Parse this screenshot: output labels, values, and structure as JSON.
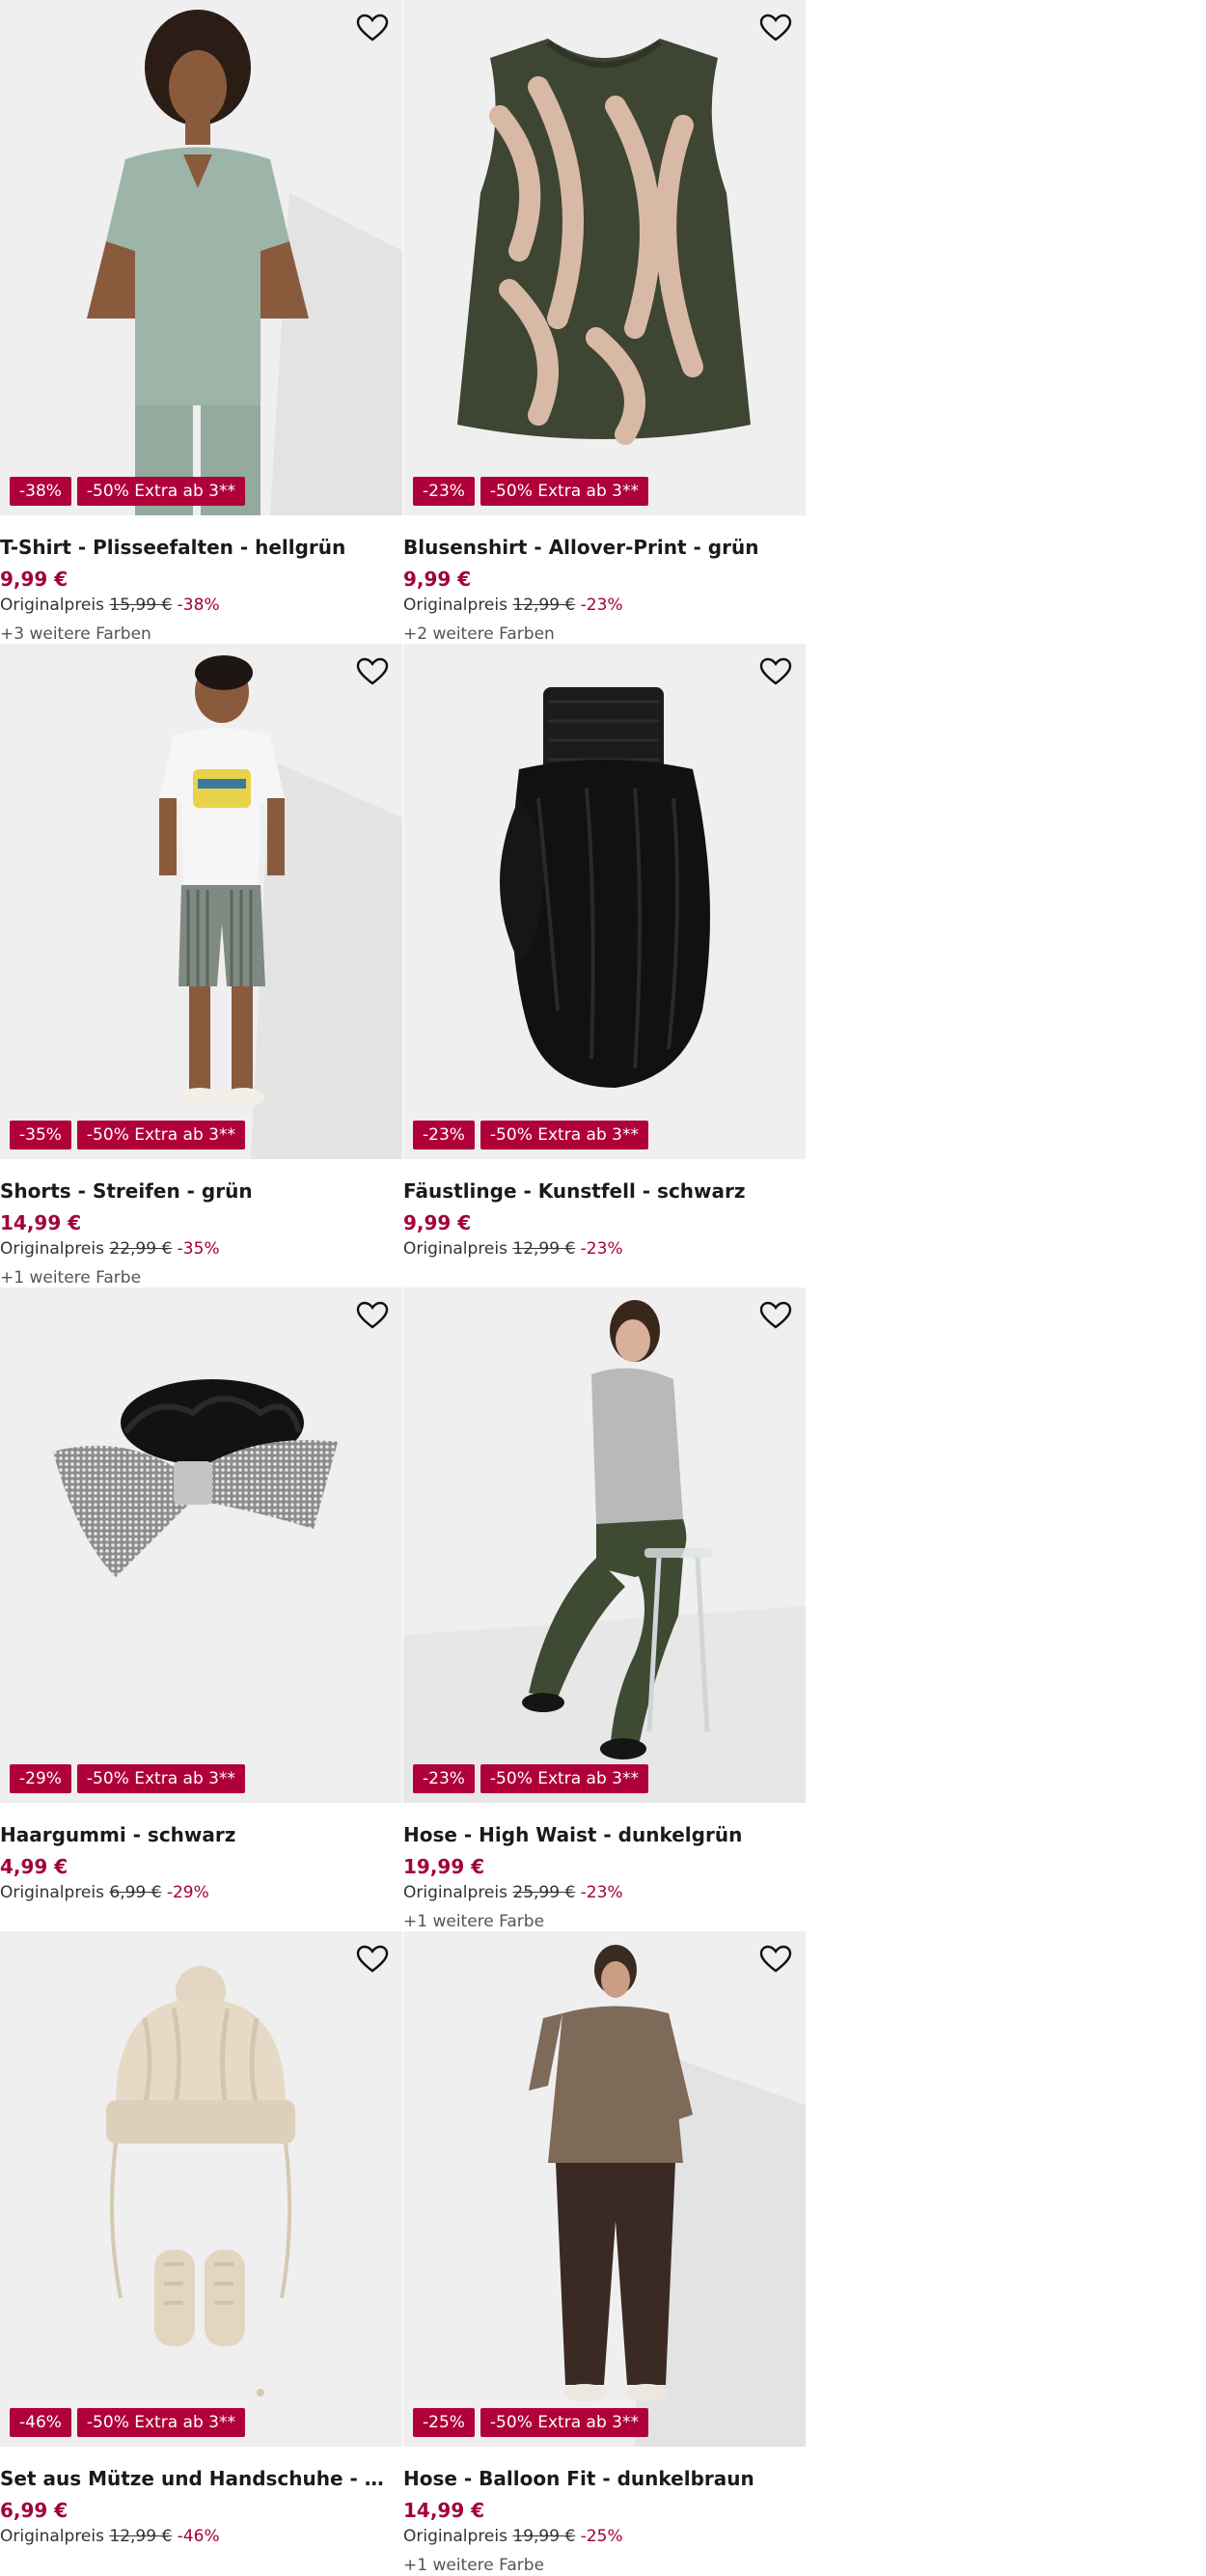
{
  "labels": {
    "original_prefix": "Originalpreis",
    "extra_badge": "-50% Extra ab 3**"
  },
  "colors": {
    "badge": "#b0003a",
    "price": "#a3003a",
    "image_bg": "#efefef"
  },
  "products": [
    {
      "title": "T-Shirt - Plisseefalten - hellgrün",
      "price": "9,99 €",
      "original_price": "15,99 €",
      "discount": "-38%",
      "more_colors": "+3 weitere Farben",
      "image": "woman-in-sage-green-pleated-tshirt"
    },
    {
      "title": "Blusenshirt - Allover-Print - grün",
      "price": "9,99 €",
      "original_price": "12,99 €",
      "discount": "-23%",
      "more_colors": "+2 weitere Farben",
      "image": "green-sleeveless-blouse-with-leaf-print"
    },
    {
      "title": "Shorts - Streifen - grün",
      "price": "14,99 €",
      "original_price": "22,99 €",
      "discount": "-35%",
      "more_colors": "+1 weitere Farbe",
      "image": "man-in-striped-shorts-and-print-tshirt"
    },
    {
      "title": "Fäustlinge - Kunstfell - schwarz",
      "price": "9,99 €",
      "original_price": "12,99 €",
      "discount": "-23%",
      "more_colors": "",
      "image": "black-faux-fur-mitten"
    },
    {
      "title": "Haargummi - schwarz",
      "price": "4,99 €",
      "original_price": "6,99 €",
      "discount": "-29%",
      "more_colors": "",
      "image": "black-velvet-scrunchie-with-rhinestone-bow"
    },
    {
      "title": "Hose - High Waist - dunkelgrün",
      "price": "19,99 €",
      "original_price": "25,99 €",
      "discount": "-23%",
      "more_colors": "+1 weitere Farbe",
      "image": "woman-in-dark-green-leather-look-pants"
    },
    {
      "title": "Set aus Mütze und Handschuhe - Zopfstrick - beige",
      "price": "6,99 €",
      "original_price": "12,99 €",
      "discount": "-46%",
      "more_colors": "",
      "image": "beige-cable-knit-hat-and-mittens-set"
    },
    {
      "title": "Hose - Balloon Fit - dunkelbraun",
      "price": "14,99 €",
      "original_price": "19,99 €",
      "discount": "-25%",
      "more_colors": "+1 weitere Farbe",
      "image": "woman-in-dark-brown-balloon-pants"
    }
  ]
}
